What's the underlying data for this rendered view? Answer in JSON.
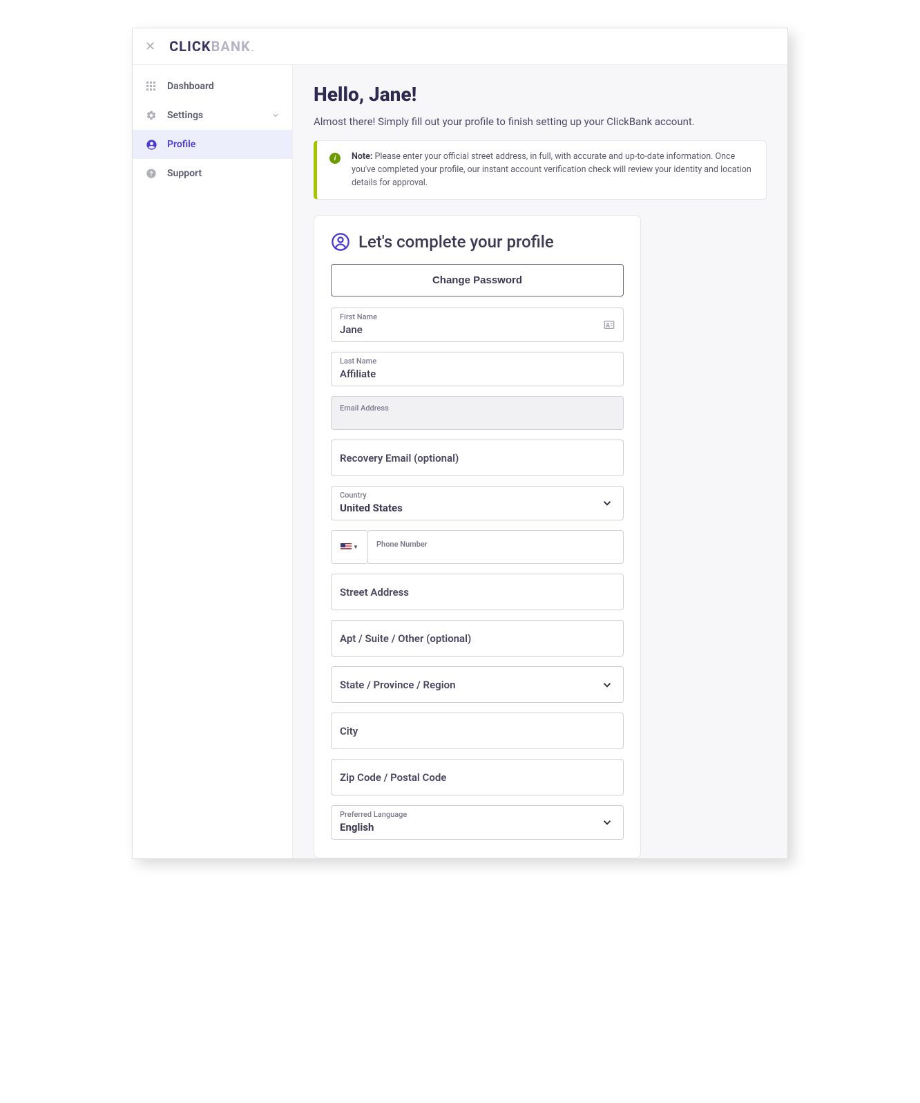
{
  "logo": {
    "part1": "CLICK",
    "part2": "BANK",
    "dot": "."
  },
  "sidebar": {
    "items": [
      {
        "label": "Dashboard"
      },
      {
        "label": "Settings"
      },
      {
        "label": "Profile"
      },
      {
        "label": "Support"
      }
    ]
  },
  "page": {
    "title": "Hello, Jane!",
    "subtitle": "Almost there! Simply fill out your profile to finish setting up your ClickBank account."
  },
  "note": {
    "strong": "Note:",
    "text": " Please enter your official street address, in full, with accurate and up-to-date information. Once you've completed your profile, our instant account verification check will review your identity and location details for approval."
  },
  "card": {
    "title": "Let's complete your profile",
    "change_password": "Change Password"
  },
  "fields": {
    "first_name": {
      "label": "First Name",
      "value": "Jane"
    },
    "last_name": {
      "label": "Last Name",
      "value": "Affiliate"
    },
    "email": {
      "label": "Email Address"
    },
    "recovery_email": {
      "placeholder": "Recovery Email (optional)"
    },
    "country": {
      "label": "Country",
      "value": "United States"
    },
    "phone": {
      "label": "Phone Number"
    },
    "street": {
      "placeholder": "Street Address"
    },
    "apt": {
      "placeholder": "Apt / Suite / Other (optional)"
    },
    "state": {
      "placeholder": "State / Province / Region"
    },
    "city": {
      "placeholder": "City"
    },
    "zip": {
      "placeholder": "Zip Code / Postal Code"
    },
    "language": {
      "label": "Preferred Language",
      "value": "English"
    }
  }
}
